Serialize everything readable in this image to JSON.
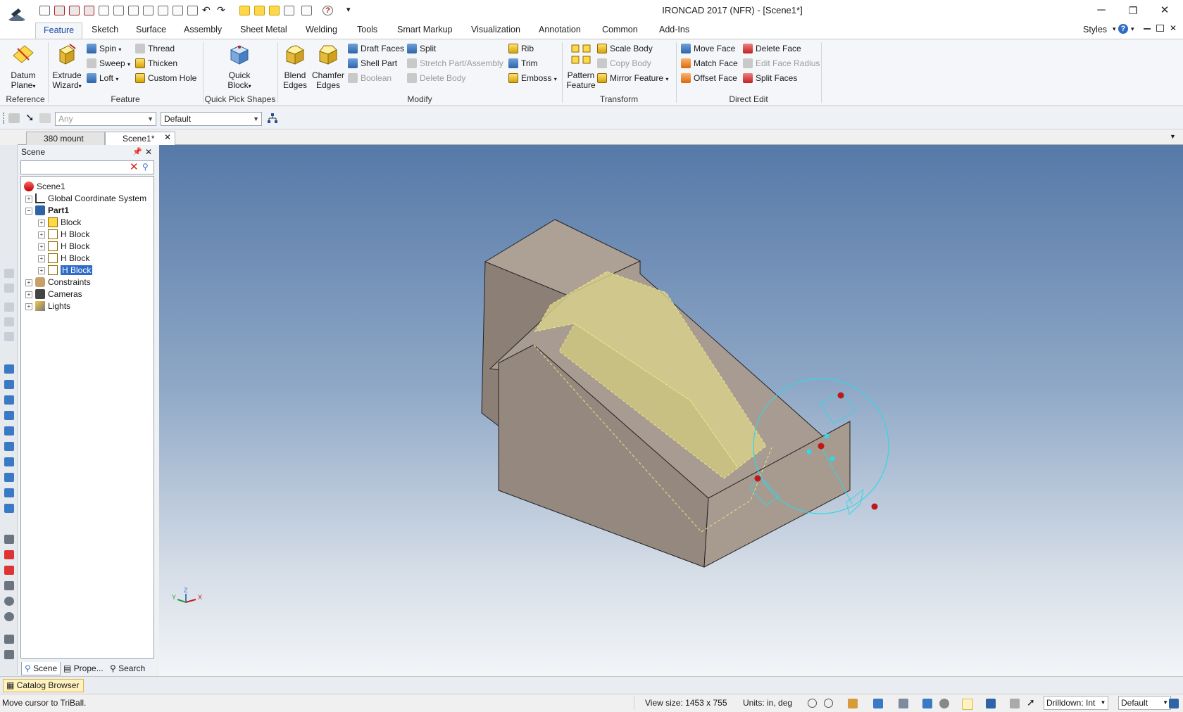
{
  "window": {
    "title": "IRONCAD 2017 (NFR) - [Scene1*]",
    "minimize": "─",
    "restore": "❐",
    "close": "✕"
  },
  "quick_access": {
    "more": "▾"
  },
  "ribbon_tabs": [
    "Feature",
    "Sketch",
    "Surface",
    "Assembly",
    "Sheet Metal",
    "Welding",
    "Tools",
    "Smart Markup",
    "Visualization",
    "Annotation",
    "Common",
    "Add-Ins"
  ],
  "styles_label": "Styles",
  "ribbon": {
    "reference": {
      "label": "Reference",
      "datum_plane": [
        "Datum",
        "Plane"
      ]
    },
    "feature": {
      "label": "Feature",
      "extrude_wizard": [
        "Extrude",
        "Wizard"
      ],
      "spin": "Spin",
      "sweep": "Sweep",
      "loft": "Loft",
      "thread": "Thread",
      "thicken": "Thicken",
      "custom_hole": "Custom Hole"
    },
    "quick_pick": {
      "label": "Quick Pick Shapes",
      "quick_block": [
        "Quick",
        "Block"
      ]
    },
    "modify": {
      "label": "Modify",
      "blend_edges": [
        "Blend",
        "Edges"
      ],
      "chamfer_edges": [
        "Chamfer",
        "Edges"
      ],
      "draft_faces": "Draft Faces",
      "shell_part": "Shell Part",
      "boolean": "Boolean",
      "split": "Split",
      "stretch": "Stretch Part/Assembly",
      "delete_body": "Delete Body",
      "rib": "Rib",
      "trim": "Trim",
      "emboss": "Emboss"
    },
    "transform": {
      "label": "Transform",
      "pattern_feature": [
        "Pattern",
        "Feature"
      ],
      "scale_body": "Scale Body",
      "copy_body": "Copy Body",
      "mirror_feature": "Mirror Feature"
    },
    "direct_edit": {
      "label": "Direct Edit",
      "move_face": "Move Face",
      "match_face": "Match Face",
      "offset_face": "Offset Face",
      "delete_face": "Delete Face",
      "edit_face_radius": "Edit Face Radius",
      "split_faces": "Split Faces"
    },
    "dropdown_arrow": "▾"
  },
  "toolbar": {
    "filter_placeholder": "Any",
    "style_value": "Default"
  },
  "doc_tabs": [
    "380 mount",
    "Scene1*"
  ],
  "scene_panel": {
    "title": "Scene",
    "tree": [
      {
        "label": "Scene1"
      },
      {
        "label": "Global Coordinate System"
      },
      {
        "label": "Part1"
      },
      {
        "label": "Block"
      },
      {
        "label": "H Block"
      },
      {
        "label": "H Block"
      },
      {
        "label": "H Block"
      },
      {
        "label": "H Block"
      },
      {
        "label": "Constraints"
      },
      {
        "label": "Cameras"
      },
      {
        "label": "Lights"
      }
    ],
    "tabs": [
      "Scene",
      "Prope...",
      "Search"
    ]
  },
  "viewport": {
    "axis": {
      "x": "X",
      "y": "Y",
      "z": "Z"
    }
  },
  "catalog_browser": "Catalog Browser",
  "status": {
    "message": "Move cursor to TriBall.",
    "view_size": "View size: 1453 x  755",
    "units": "Units: in, deg",
    "drilldown": "Drilldown: Int",
    "style": "Default"
  },
  "colors": {
    "body_face": "#a89b91",
    "highlight_face": "#d6cf8a",
    "triball": "#33d6e6",
    "accent_blue": "#1e4fa0"
  }
}
